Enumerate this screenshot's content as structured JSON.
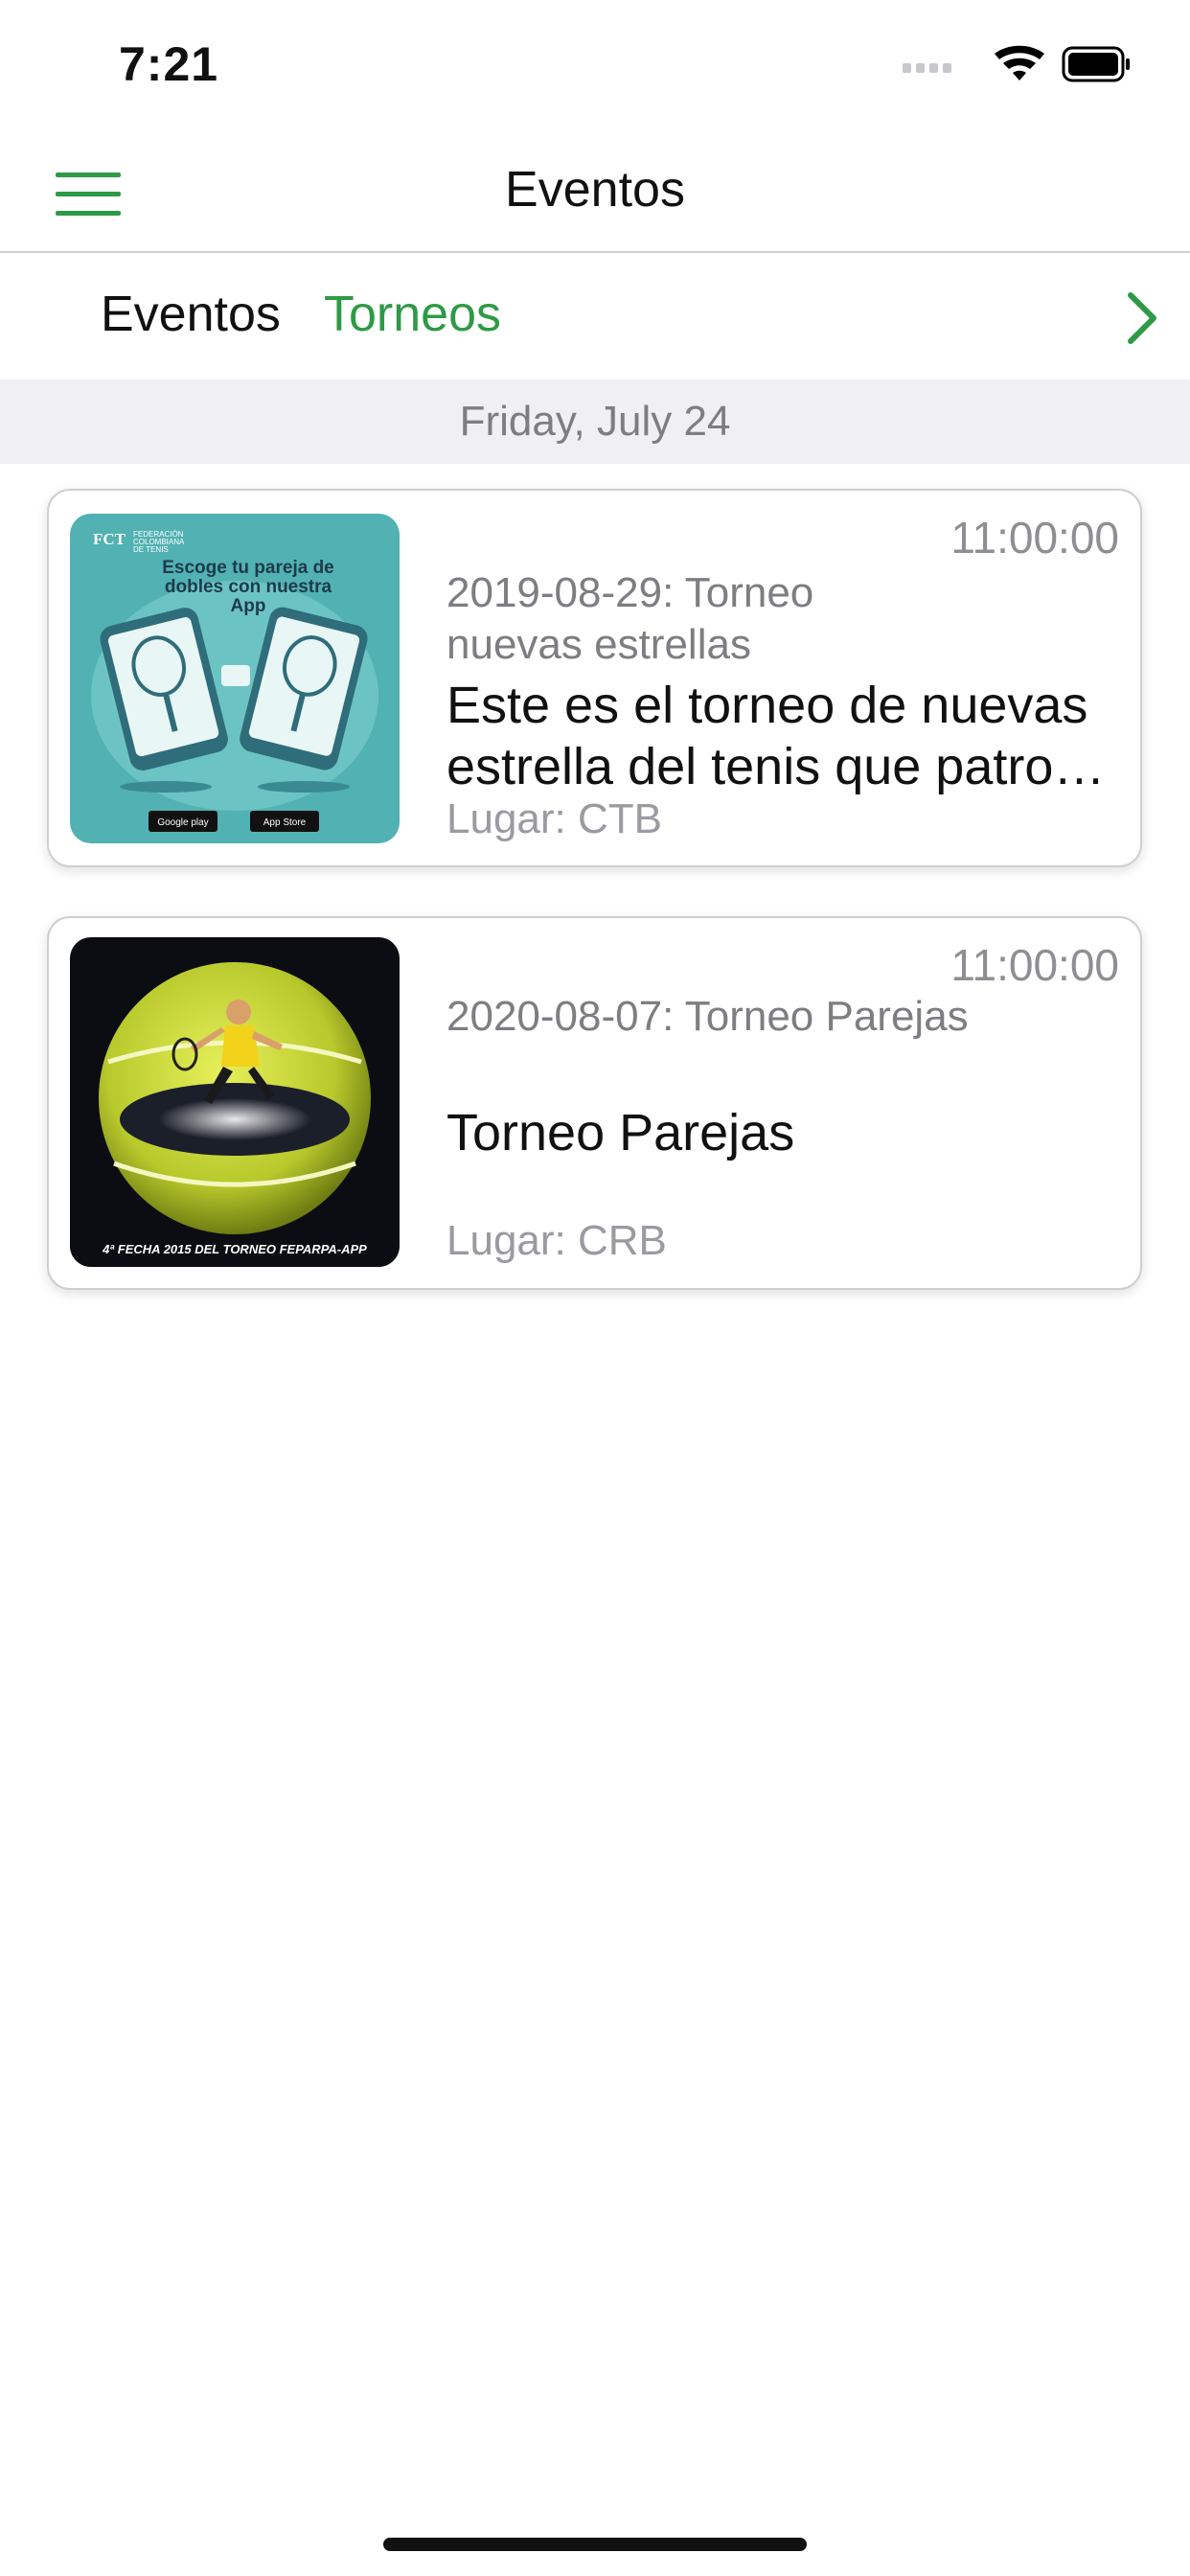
{
  "status_bar": {
    "time": "7:21"
  },
  "nav": {
    "title": "Eventos"
  },
  "tabs": [
    {
      "label": "Eventos",
      "active": false
    },
    {
      "label": "Torneos",
      "active": true
    }
  ],
  "section": {
    "date": "Friday, July 24"
  },
  "events": [
    {
      "time": "11:00:00",
      "subtitle": "2019-08-29: Torneo nuevas estrellas",
      "title_line1": "Este es el torneo de nuevas",
      "title_line2": "estrella del tenis que patrocina",
      "place": "Lugar: CTB",
      "image": {
        "heading": "Escoge tu pareja de dobles con nuestra App",
        "logo_text": "FEDERACIÓN COLOMBIANA DE TENIS",
        "logo_abbr": "FCT",
        "badge_google": "Google play",
        "badge_apple": "App Store"
      }
    },
    {
      "time": "11:00:00",
      "subtitle": "2020-08-07: Torneo Parejas",
      "title": "Torneo Parejas",
      "place": "Lugar: CRB",
      "image": {
        "caption": "4ª FECHA 2015 DEL TORNEO FEPARPA-APP"
      }
    }
  ],
  "colors": {
    "accent": "#2e9a46",
    "section_bg": "#efeff4",
    "secondary_text": "#7d7d82"
  }
}
